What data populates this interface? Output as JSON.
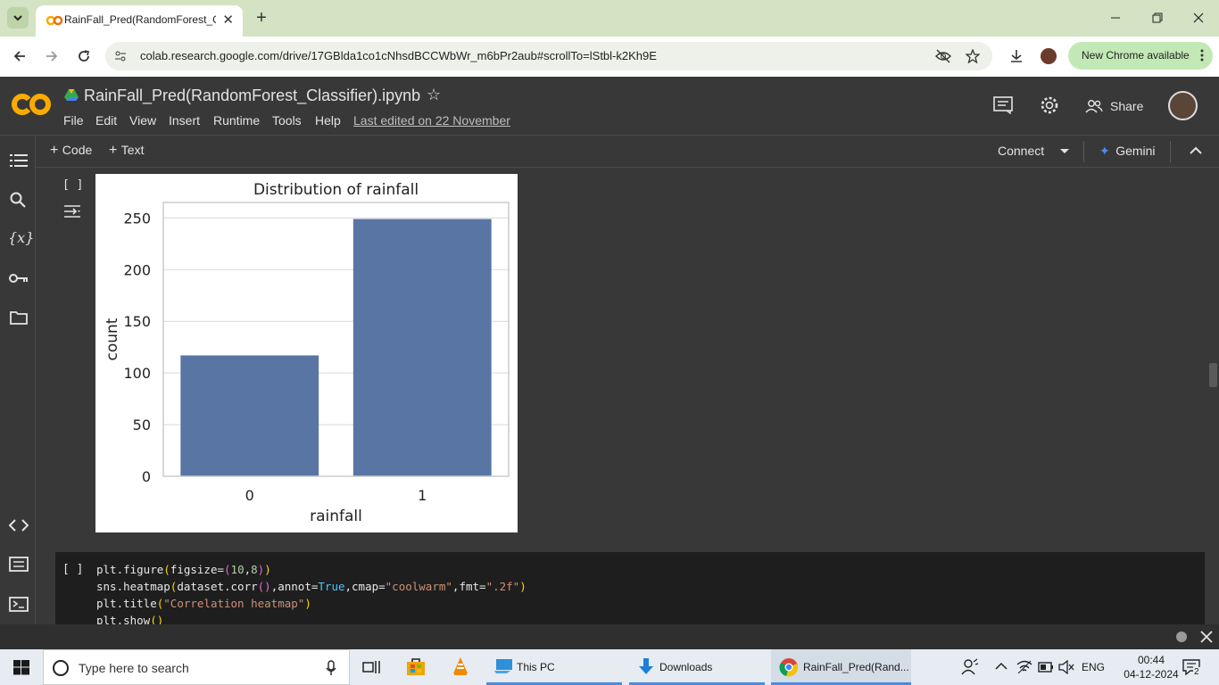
{
  "browser": {
    "tab_title": "RainFall_Pred(RandomForest_Cl",
    "url": "colab.research.google.com/drive/17GBlda1co1cNhsdBCCWbWr_m6bPr2aub#scrollTo=lStbl-k2Kh9E",
    "new_chrome_label": "New Chrome available",
    "icons": [
      "chevron-down-icon",
      "plus-icon",
      "minimize-icon",
      "restore-icon",
      "close-icon",
      "back-icon",
      "forward-icon",
      "reload-icon",
      "site-info-icon",
      "eye-off-icon",
      "star-icon",
      "download-icon",
      "profile-avatar",
      "more-vert-icon"
    ]
  },
  "colab": {
    "logo": "CO",
    "notebook_title": "RainFall_Pred(RandomForest_Classifier).ipynb",
    "menu": [
      "File",
      "Edit",
      "View",
      "Insert",
      "Runtime",
      "Tools",
      "Help"
    ],
    "last_edited": "Last edited on 22 November",
    "share_label": "Share",
    "add_code": "Code",
    "add_text": "Text",
    "connect_label": "Connect",
    "gemini_label": "Gemini",
    "run_cell_1": "[ ]",
    "run_cell_2": "[ ]",
    "code_lines": [
      "plt.figure(figsize=(10,8))",
      "sns.heatmap(dataset.corr(),annot=True,cmap=\"coolwarm\",fmt=\".2f\")",
      "plt.title(\"Correlation heatmap\")",
      "plt.show()"
    ]
  },
  "chart_data": {
    "type": "bar",
    "title": "Distribution of rainfall",
    "xlabel": "rainfall",
    "ylabel": "count",
    "categories": [
      "0",
      "1"
    ],
    "values": [
      117,
      249
    ],
    "ylim": [
      0,
      265
    ],
    "yticks": [
      0,
      50,
      100,
      150,
      200,
      250
    ],
    "grid": true,
    "bar_color": "#5875a4"
  },
  "taskbar": {
    "search_placeholder": "Type here to search",
    "apps": [
      {
        "label": "This PC"
      },
      {
        "label": "Downloads"
      },
      {
        "label": "RainFall_Pred(Rand..."
      }
    ],
    "lang": "ENG",
    "time": "00:44",
    "date": "04-12-2024",
    "notif_count": "2"
  }
}
